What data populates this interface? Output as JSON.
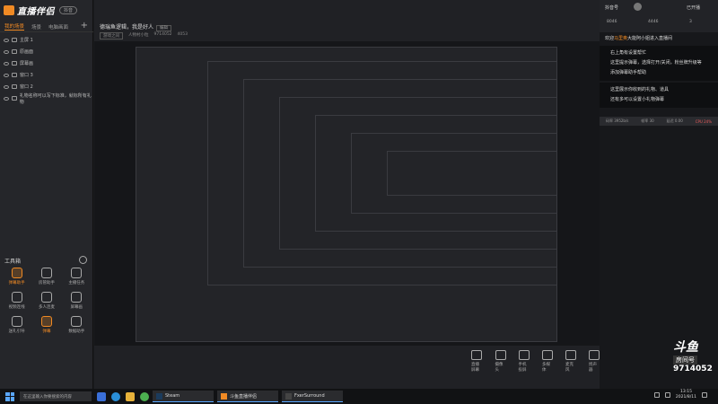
{
  "app": {
    "logo_text": "直播伴侣",
    "version_badge": "抖音"
  },
  "scene_tabs": [
    {
      "label": "我的场景",
      "active": true
    },
    {
      "label": "场景"
    },
    {
      "label": "电脑画面"
    }
  ],
  "layers": [
    {
      "label": "主屏 1"
    },
    {
      "label": "原画面"
    },
    {
      "label": "屏幕画"
    },
    {
      "label": "窗口 3"
    },
    {
      "label": "窗口 2"
    },
    {
      "label": "礼物名称可以写下标准，就标所有礼物"
    }
  ],
  "toolbox": {
    "title": "工具箱",
    "tools": [
      {
        "label": "弹幕助手",
        "hot": true
      },
      {
        "label": "房管助手"
      },
      {
        "label": "主播任务"
      },
      {
        "label": "视频连线"
      },
      {
        "label": "多人连麦"
      },
      {
        "label": "屏幕画"
      },
      {
        "label": "送礼引导"
      },
      {
        "label": "弹幕",
        "hot": true
      },
      {
        "label": "数据助手"
      }
    ]
  },
  "room": {
    "title": "德瑞鱼逻辑，我是好人",
    "edit_label": "编辑",
    "category": "游戏之间",
    "meta": [
      "人物村小粒",
      "9714052",
      "4053"
    ]
  },
  "bottom_tools": [
    {
      "label": "直播屏幕"
    },
    {
      "label": "摄像头"
    },
    {
      "label": "手机投屏"
    },
    {
      "label": "多媒体"
    },
    {
      "label": "麦克风"
    },
    {
      "label": "扬声器"
    }
  ],
  "right_panel": {
    "anchor_name": "抖音号",
    "live_status": "已开播",
    "stats": [
      "8046",
      "4446",
      "3"
    ],
    "chat": [
      {
        "prefix": "欢迎",
        "highlight": "马里奥",
        "text": "大能阿小姐进入直播间"
      },
      {
        "text": "右上角有设置帮忙"
      },
      {
        "text": "这里提示弹幕，选择打开/关闭，粉丝牌升级等"
      },
      {
        "text": "添加弹幕助手帮助"
      },
      {
        "text": "这里展示你收到的礼物、道具"
      },
      {
        "text": "还有多可以设置小礼物弹幕"
      }
    ],
    "stream_stats": [
      "码率 3952b/s",
      "帧率 30",
      "延迟 0.00",
      "CPU 24%"
    ],
    "platform_logo": "斗鱼",
    "room_label": "房间号",
    "room_number": "9714052"
  },
  "taskbar": {
    "search_placeholder": "在这里输入你要搜索的内容",
    "apps": [
      {
        "label": "Steam"
      },
      {
        "label": "斗鱼直播伴侣"
      },
      {
        "label": "FxerSurround"
      }
    ],
    "time": "13:15",
    "date": "2021/8/11"
  }
}
